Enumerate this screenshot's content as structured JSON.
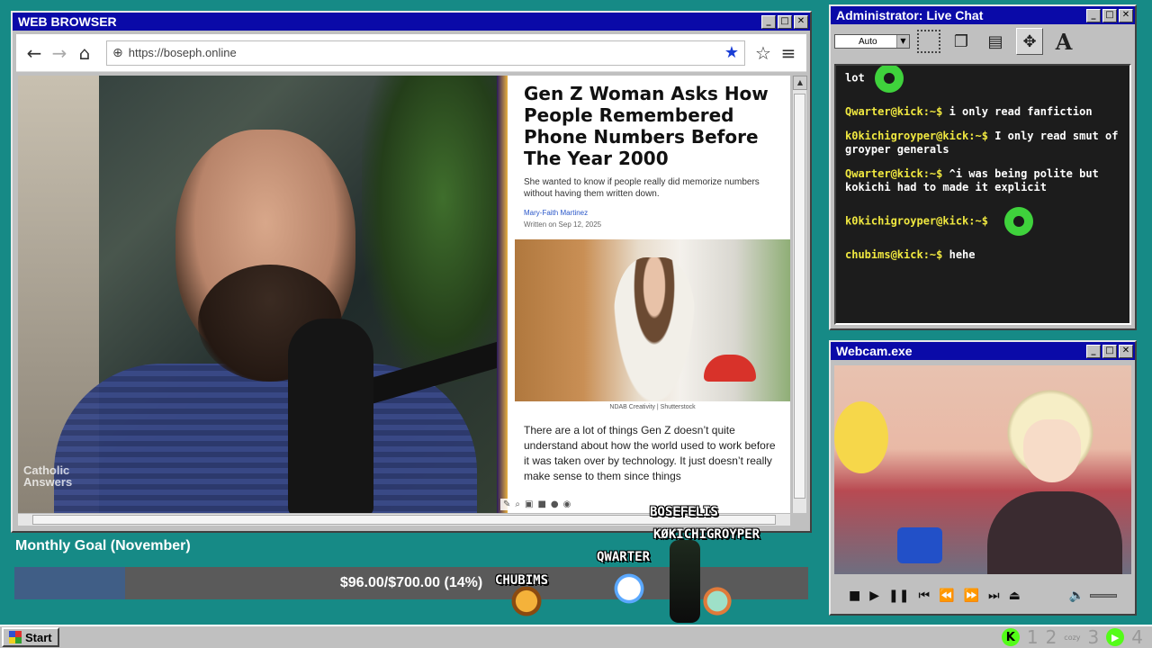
{
  "browser": {
    "title": "WEB BROWSER",
    "url": "https://boseph.online",
    "article": {
      "title": "Gen Z Woman Asks How People Remembered Phone Numbers Before The Year 2000",
      "subtitle": "She wanted to know if people really did memorize numbers without having them written down.",
      "author": "Mary-Faith Martinez",
      "date": "Written on Sep 12, 2025",
      "image_credit": "NDAB Creativity | Shutterstock",
      "body": "There are a lot of things Gen Z doesn’t quite understand about how the world used to work before it was taken over by technology. It just doesn’t really make sense to them since things"
    },
    "watermark": "Catholic Answers"
  },
  "chat": {
    "title": "Administrator: Live Chat",
    "auto_label": "Auto",
    "messages": [
      {
        "user": "",
        "text": "lot",
        "emote": "laughing-emote"
      },
      {
        "user": "Qwarter@kick:~$",
        "text": "i only read fanfiction"
      },
      {
        "user": "k0kichigroyper@kick:~$",
        "text": "I only read smut of groyper generals"
      },
      {
        "user": "Qwarter@kick:~$",
        "text": "^i was being polite but kokichi had to made it explicit"
      },
      {
        "user": "k0kichigroyper@kick:~$",
        "text": "",
        "emote": "laughing-emote"
      },
      {
        "user": "chubims@kick:~$",
        "text": "hehe"
      }
    ]
  },
  "webcam": {
    "title": "Webcam.exe"
  },
  "goal": {
    "label": "Monthly Goal (November)",
    "text": "$96.00/$700.00 (14%)",
    "progress": 0.14,
    "fill_color": "#405e86"
  },
  "viewers": {
    "bosefelis": "BOSEFELIS",
    "kokichi": "KØKICHIGROYPER",
    "qwarter": "QWARTER",
    "chubims": "CHUBIMS"
  },
  "taskbar": {
    "start": "Start",
    "tray_numbers": [
      "1",
      "2",
      "3",
      "4"
    ],
    "cozy": "cozy"
  },
  "colors": {
    "desktop": "#168a86",
    "titlebar": "#0a0aa8",
    "chat_user": "#f0e840",
    "kick_green": "#53fc18"
  }
}
